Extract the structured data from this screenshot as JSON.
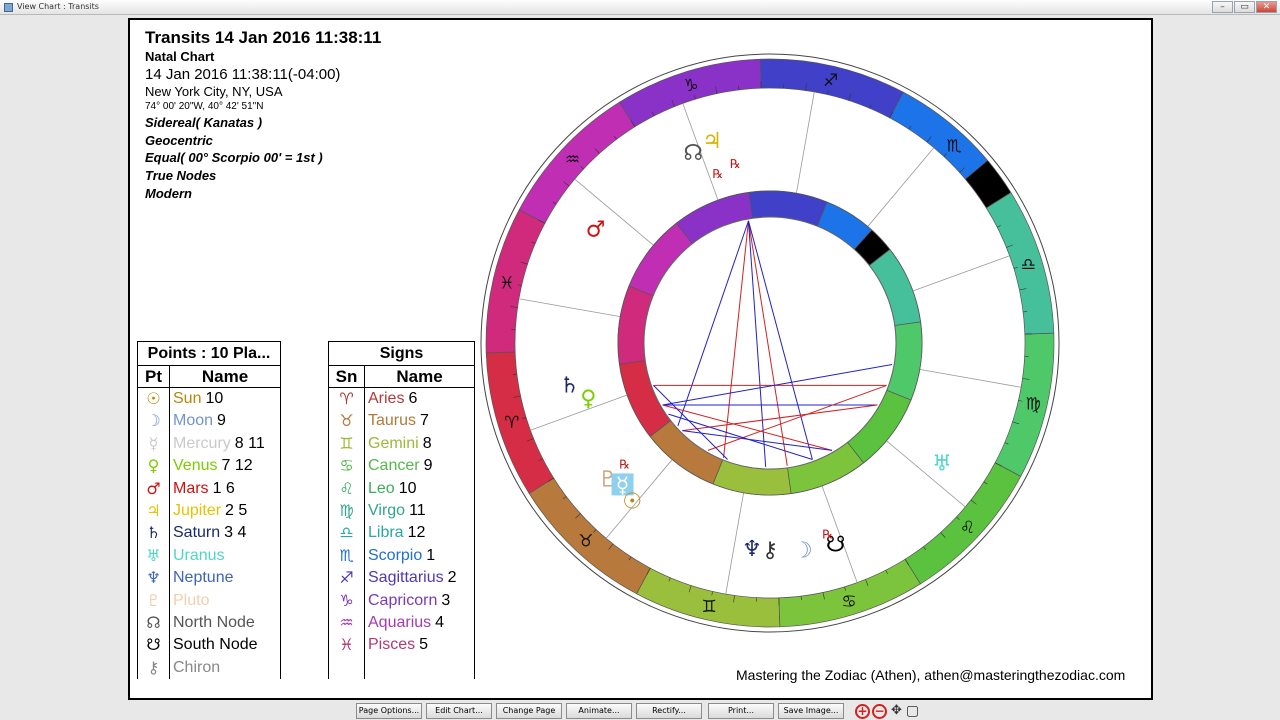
{
  "window": {
    "title": "View Chart : Transits",
    "min": "–",
    "max": "▭",
    "close": "✕"
  },
  "header": {
    "title": "Transits 14 Jan 2016 11:38:11",
    "subtitle": "Natal Chart",
    "date": "14 Jan 2016 11:38:11(-04:00)",
    "place": "New York City, NY, USA",
    "coords": "74° 00' 20\"W, 40° 42' 51\"N",
    "zodiac": "Sidereal( Kanatas )",
    "centric": "Geocentric",
    "houses": "Equal( 00° Scorpio 00' = 1st )",
    "nodes": "True Nodes",
    "mode": "Modern"
  },
  "points_table": {
    "caption": "Points : 10 Pla...",
    "col_pt": "Pt",
    "col_name": "Name",
    "rows": [
      {
        "glyph": "☉",
        "name": "Sun",
        "nums": "10",
        "color": "#b8860b"
      },
      {
        "glyph": "☽",
        "name": "Moon",
        "nums": "9",
        "color": "#6f95c8"
      },
      {
        "glyph": "☿",
        "name": "Mercury",
        "nums": "8 11",
        "color": "#c9c9c9"
      },
      {
        "glyph": "♀",
        "name": "Venus",
        "nums": "7 12",
        "color": "#7ccd00"
      },
      {
        "glyph": "♂",
        "name": "Mars",
        "nums": "1 6",
        "color": "#cc1111"
      },
      {
        "glyph": "♃",
        "name": "Jupiter",
        "nums": "2 5",
        "color": "#e6c300"
      },
      {
        "glyph": "♄",
        "name": "Saturn",
        "nums": "3 4",
        "color": "#1a2a6b"
      },
      {
        "glyph": "♅",
        "name": "Uranus",
        "nums": "",
        "color": "#4fd6c4"
      },
      {
        "glyph": "♆",
        "name": "Neptune",
        "nums": "",
        "color": "#3f63b5"
      },
      {
        "glyph": "♇",
        "name": "Pluto",
        "nums": "",
        "color": "#f2cfae"
      },
      {
        "glyph": "☊",
        "name": "North Node",
        "nums": "",
        "color": "#555555"
      },
      {
        "glyph": "☋",
        "name": "South Node",
        "nums": "",
        "color": "#000000"
      },
      {
        "glyph": "⚷",
        "name": "Chiron",
        "nums": "",
        "color": "#888888"
      }
    ]
  },
  "signs_table": {
    "caption": "Signs",
    "col_sn": "Sn",
    "col_name": "Name",
    "rows": [
      {
        "glyph": "♈",
        "name": "Aries",
        "num": "6",
        "color": "#b03a3a"
      },
      {
        "glyph": "♉",
        "name": "Taurus",
        "num": "7",
        "color": "#b07a3a"
      },
      {
        "glyph": "♊",
        "name": "Gemini",
        "num": "8",
        "color": "#9bb83a"
      },
      {
        "glyph": "♋",
        "name": "Cancer",
        "num": "9",
        "color": "#55b84a"
      },
      {
        "glyph": "♌",
        "name": "Leo",
        "num": "10",
        "color": "#3cae5a"
      },
      {
        "glyph": "♍",
        "name": "Virgo",
        "num": "11",
        "color": "#2fa88a"
      },
      {
        "glyph": "♎",
        "name": "Libra",
        "num": "12",
        "color": "#2aa7a7"
      },
      {
        "glyph": "♏",
        "name": "Scorpio",
        "num": "1",
        "color": "#1f6fd0"
      },
      {
        "glyph": "♐",
        "name": "Sagittarius",
        "num": "2",
        "color": "#4b3ab8"
      },
      {
        "glyph": "♑",
        "name": "Capricorn",
        "num": "3",
        "color": "#7a3ab8"
      },
      {
        "glyph": "♒",
        "name": "Aquarius",
        "num": "4",
        "color": "#a33ab0"
      },
      {
        "glyph": "♓",
        "name": "Pisces",
        "num": "5",
        "color": "#b03a70"
      }
    ]
  },
  "wheel": {
    "sign_glyphs": [
      "♈",
      "♉",
      "♊",
      "♋",
      "♌",
      "♍",
      "♎",
      "♏",
      "♐",
      "♑",
      "♒",
      "♓"
    ],
    "sign_colors": [
      "#d42d45",
      "#b8793c",
      "#99bf3d",
      "#7cc43b",
      "#5ac23e",
      "#4fc86a",
      "#45c09a",
      "#1d73e8",
      "#4040c8",
      "#8a32c8",
      "#c02eb4",
      "#d02a7c"
    ],
    "retro_mark": "℞",
    "outer_planets": [
      {
        "name": "North Node",
        "glyph": "☊",
        "color": "#555555",
        "retro": true
      },
      {
        "name": "Jupiter",
        "glyph": "♃",
        "color": "#d6b400",
        "retro": true
      },
      {
        "name": "Mars",
        "glyph": "♂",
        "color": "#cc1111",
        "retro": false
      },
      {
        "name": "Saturn",
        "glyph": "♄",
        "color": "#1a2a6b",
        "retro": false
      },
      {
        "name": "Venus",
        "glyph": "♀",
        "color": "#7ccd00",
        "retro": false
      },
      {
        "name": "Pluto",
        "glyph": "♇",
        "color": "#c9a77a",
        "retro": true
      },
      {
        "name": "Mercury",
        "glyph": "☿",
        "color": "#ffffff",
        "retro": false
      },
      {
        "name": "Sun",
        "glyph": "☉",
        "color": "#b8860b",
        "retro": false
      },
      {
        "name": "Neptune",
        "glyph": "♆",
        "color": "#1a2a6b",
        "retro": false
      },
      {
        "name": "Chiron",
        "glyph": "⚷",
        "color": "#333333",
        "retro": false
      },
      {
        "name": "Moon",
        "glyph": "☽",
        "color": "#6f95c8",
        "retro": false
      },
      {
        "name": "South Node",
        "glyph": "☋",
        "color": "#000000",
        "retro": true
      },
      {
        "name": "Uranus",
        "glyph": "♅",
        "color": "#4fd6c4",
        "retro": false
      }
    ]
  },
  "credit": "Mastering the Zodiac (Athen), athen@masteringthezodiac.com",
  "toolbar": {
    "buttons": [
      "Page Options...",
      "Edit Chart...",
      "Change Page",
      "Animate...",
      "Rectify...",
      "Print...",
      "Save Image..."
    ],
    "zoom_in": "+",
    "zoom_out": "−",
    "move": "✥",
    "fit": "▢"
  }
}
